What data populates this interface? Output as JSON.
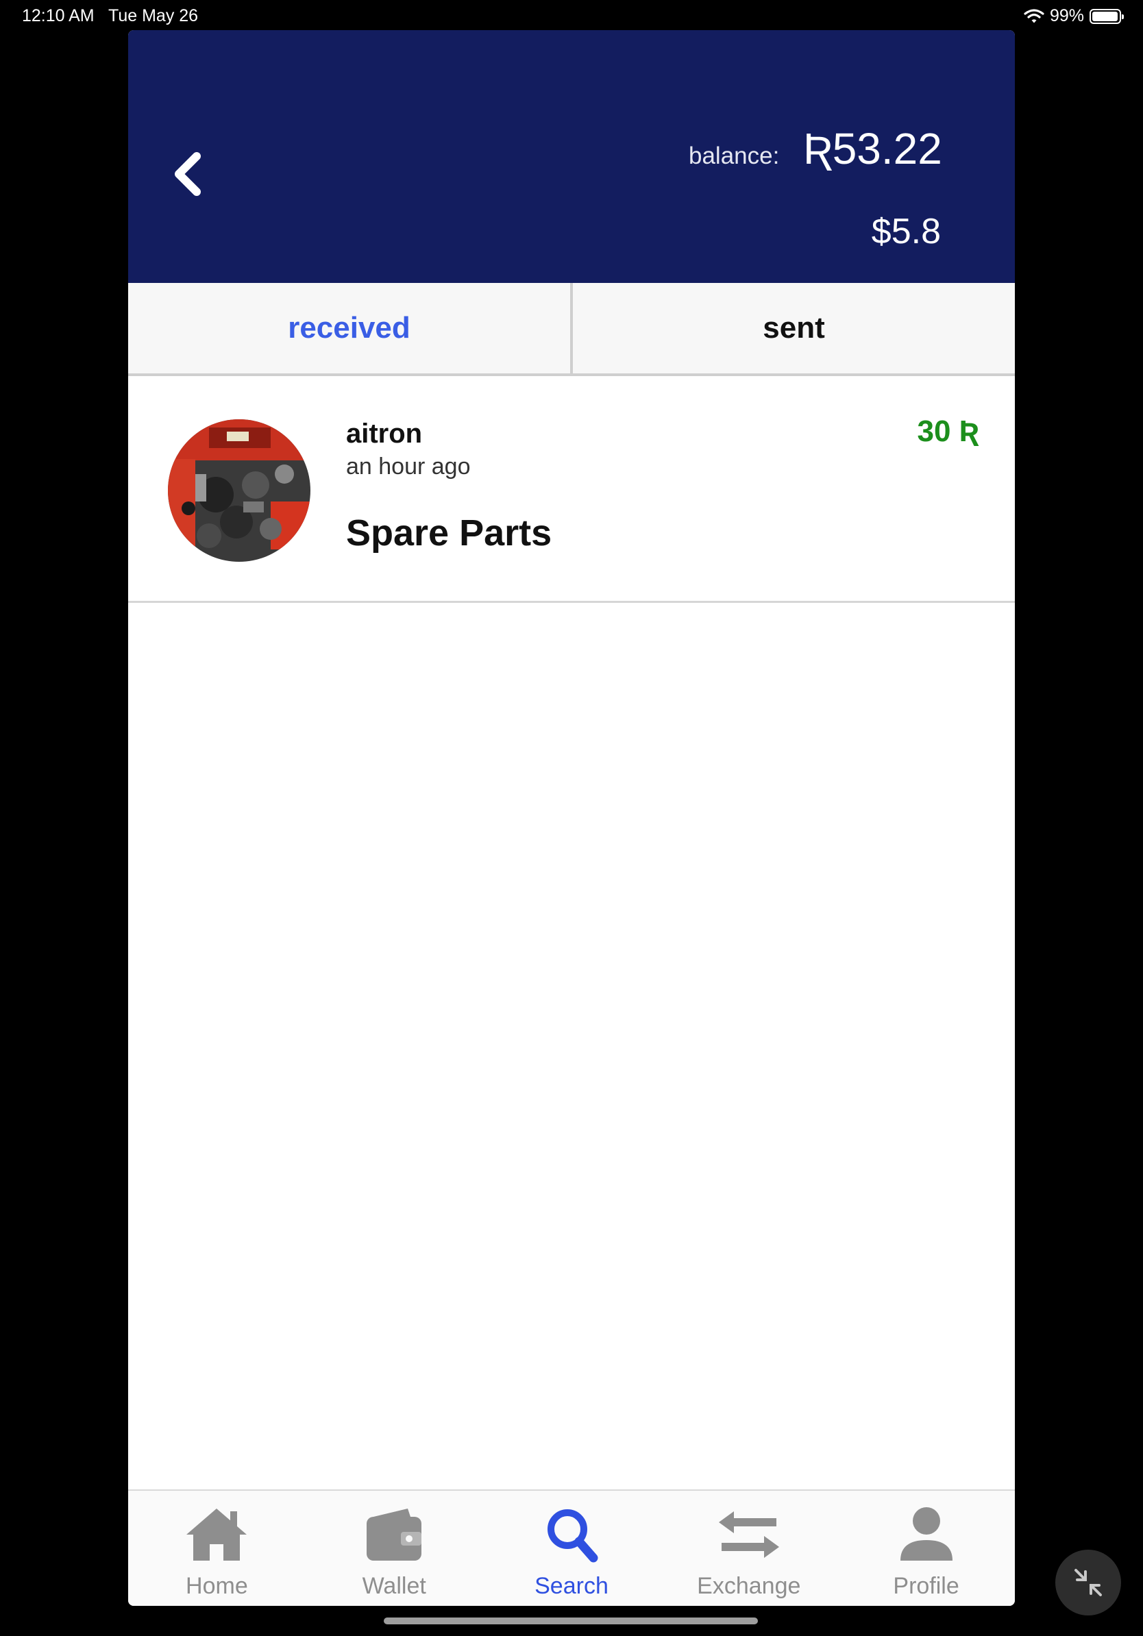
{
  "status": {
    "time": "12:10 AM",
    "date": "Tue May 26",
    "battery": "99%",
    "battery_level": 0.99
  },
  "header": {
    "balance_label": "balance:",
    "balance_value": "Ʀ53.22",
    "usd_value": "$5.8",
    "background_color": "#131d5f",
    "icons": {
      "back": "back-chevron-icon"
    }
  },
  "tabs": [
    {
      "label": "received",
      "active": true
    },
    {
      "label": "sent",
      "active": false
    }
  ],
  "transactions": [
    {
      "name": "aitron",
      "time": "an hour ago",
      "note": "Spare Parts",
      "amount": "30 Ʀ",
      "amount_color": "#1c8f1c",
      "avatar": "spare-parts-photo"
    }
  ],
  "tabbar": {
    "active_color": "#2f50e0",
    "inactive_color": "#8e8e8e",
    "items": [
      {
        "label": "Home",
        "icon": "home-icon",
        "active": false
      },
      {
        "label": "Wallet",
        "icon": "wallet-icon",
        "active": false
      },
      {
        "label": "Search",
        "icon": "search-icon",
        "active": true
      },
      {
        "label": "Exchange",
        "icon": "exchange-icon",
        "active": false
      },
      {
        "label": "Profile",
        "icon": "profile-icon",
        "active": false
      }
    ]
  }
}
